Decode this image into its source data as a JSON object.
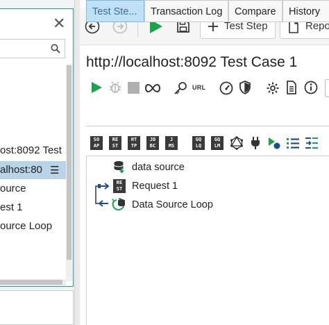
{
  "navigator": {
    "close_glyph": "✕",
    "search": {
      "placeholder": ""
    },
    "items": [
      {
        "label": "ost:8092 Test"
      },
      {
        "label": "alhost:80"
      },
      {
        "label": "ource"
      },
      {
        "label": "est 1"
      },
      {
        "label": "ource Loop"
      }
    ],
    "selected_menu_glyph": "☰"
  },
  "toolbar": {
    "test_step_label": "Test Step",
    "report_label": "Repo"
  },
  "editor": {
    "title": "http://localhost:8092 Test Case 1",
    "url_label": "URL",
    "tabs": [
      {
        "label": "Test Ste..."
      },
      {
        "label": "Transaction Log"
      },
      {
        "label": "Compare"
      },
      {
        "label": "History"
      }
    ],
    "step_icons": [
      {
        "l1": "SO",
        "l2": "AP"
      },
      {
        "l1": "RE",
        "l2": "ST"
      },
      {
        "l1": "HT",
        "l2": "TP"
      },
      {
        "l1": "JD",
        "l2": "BC"
      },
      {
        "l1": "J",
        "l2": "MS"
      },
      {
        "l1": "GQ",
        "l2": "LQ"
      },
      {
        "l1": "GQ",
        "l2": "LM"
      }
    ],
    "steps": [
      {
        "label": "data source"
      },
      {
        "label": "Request 1",
        "icon_l1": "RE",
        "icon_l2": "ST"
      },
      {
        "label": "Data Source Loop"
      }
    ]
  },
  "colors": {
    "accent_green": "#1aa34a",
    "selection_blue": "#b9d3e8",
    "active_tab": "#bfe0f5",
    "panel_border": "#2a9d9a"
  }
}
